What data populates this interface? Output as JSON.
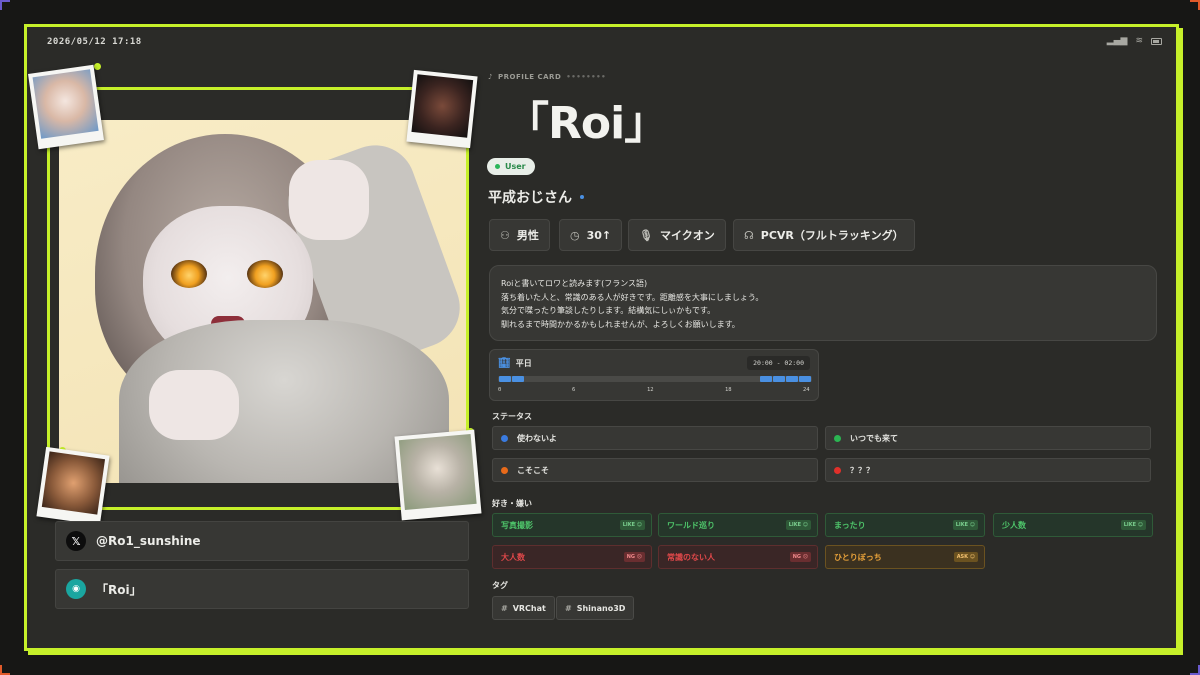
{
  "statusbar": {
    "time": "2026/05/12 17:18"
  },
  "header": {
    "label": "PROFILE CARD",
    "dots": "••••••••",
    "name": "「Roi」",
    "role": "User",
    "subname": "平成おじさん"
  },
  "chips": [
    {
      "icon": "person-icon",
      "label": "男性"
    },
    {
      "icon": "clock-icon",
      "label": "30↑"
    },
    {
      "icon": "mic-icon",
      "label": "マイクオン"
    },
    {
      "icon": "headset-icon",
      "label": "PCVR（フルトラッキング）"
    }
  ],
  "bio": [
    "Roiと書いてロワと読みます(フランス語)",
    "落ち着いた人と、常識のある人が好きです。距離感を大事にしましょう。",
    "気分で喋ったり筆談したりします。結構気にしぃかもです。",
    "馴れるまで時間かかるかもしれませんが、よろしくお願いします。"
  ],
  "schedule": {
    "title": "平日",
    "range": "20:00 - 02:00",
    "ticks": [
      "0",
      "6",
      "12",
      "18",
      "24"
    ],
    "active_hours": [
      0,
      1,
      20,
      21,
      22,
      23
    ]
  },
  "status": {
    "title": "ステータス",
    "items": [
      {
        "label": "使わないよ",
        "color": "#3a7be0"
      },
      {
        "label": "いつでも来て",
        "color": "#2bb552"
      },
      {
        "label": "こそこそ",
        "color": "#e86a1a"
      },
      {
        "label": "？？？",
        "color": "#e0302a"
      }
    ]
  },
  "likes": {
    "title": "好き・嫌い",
    "items": [
      {
        "label": "写真撮影",
        "badge": "LIKE ☺",
        "kind": "l"
      },
      {
        "label": "ワールド巡り",
        "badge": "LIKE ☺",
        "kind": "l"
      },
      {
        "label": "まったり",
        "badge": "LIKE ☺",
        "kind": "l"
      },
      {
        "label": "少人数",
        "badge": "LIKE ☺",
        "kind": "l"
      },
      {
        "label": "大人数",
        "badge": "NG ☹",
        "kind": "n"
      },
      {
        "label": "常識のない人",
        "badge": "NG ☹",
        "kind": "n"
      },
      {
        "label": "ひとりぼっち",
        "badge": "ASK ☺",
        "kind": "a"
      }
    ]
  },
  "tags": {
    "title": "タグ",
    "items": [
      "VRChat",
      "Shinano3D"
    ]
  },
  "links": [
    {
      "label": "@Ro1_sunshine",
      "icon": "x-logo-icon"
    },
    {
      "label": "「Roi」",
      "icon": "vrchat-icon"
    }
  ]
}
